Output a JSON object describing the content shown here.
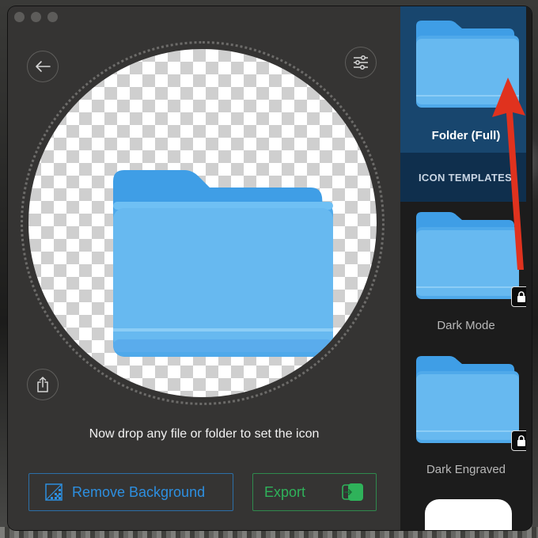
{
  "window": {
    "traffic_lights": [
      "close",
      "minimize",
      "zoom"
    ]
  },
  "toolbar": {
    "back_icon": "arrow-left-icon",
    "settings_icon": "sliders-icon",
    "share_icon": "share-icon"
  },
  "preview": {
    "icon": "folder-icon",
    "folder_color": "#67b9f0"
  },
  "drop_hint": "Now drop any file or folder to set the icon",
  "actions": {
    "remove_background_label": "Remove Background",
    "export_label": "Export"
  },
  "sidebar": {
    "selected": {
      "label": "Folder (Full)"
    },
    "section_header": "ICON TEMPLATES",
    "templates": [
      {
        "label": "Dark Mode",
        "locked": true
      },
      {
        "label": "Dark Engraved",
        "locked": true
      }
    ]
  },
  "colors": {
    "accent_blue": "#2d8fe0",
    "accent_green": "#2fb25a",
    "selected_bg": "#18466e",
    "annotation_arrow": "#e0321e"
  }
}
